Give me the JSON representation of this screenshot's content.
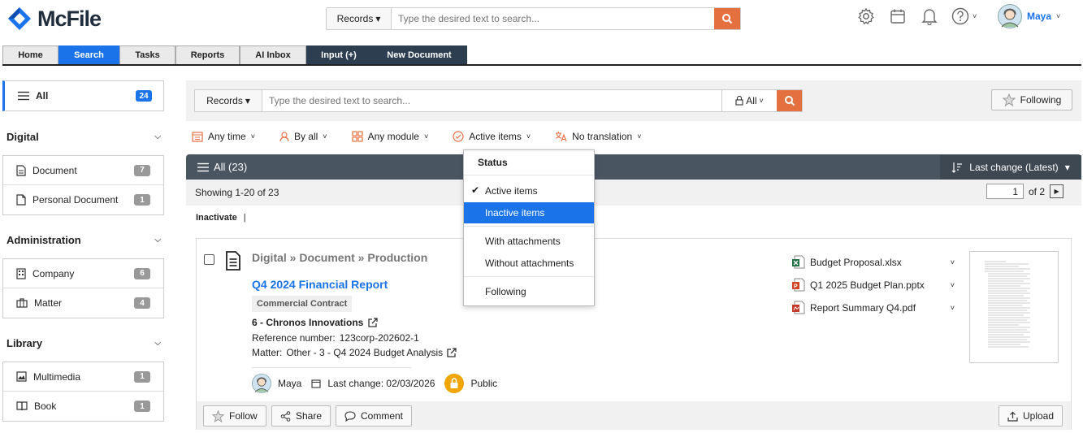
{
  "app": {
    "name": "McFile"
  },
  "top_search": {
    "scope": "Records",
    "placeholder": "Type the desired text to search..."
  },
  "user": {
    "name": "Maya"
  },
  "nav_tabs": [
    "Home",
    "Search",
    "Tasks",
    "Reports",
    "AI Inbox",
    "Input (+)",
    "New Document"
  ],
  "sidebar": {
    "all": {
      "label": "All",
      "count": "24"
    },
    "sections": [
      {
        "title": "Digital",
        "items": [
          {
            "label": "Document",
            "count": "7"
          },
          {
            "label": "Personal Document",
            "count": "1"
          }
        ]
      },
      {
        "title": "Administration",
        "items": [
          {
            "label": "Company",
            "count": "6"
          },
          {
            "label": "Matter",
            "count": "4"
          }
        ]
      },
      {
        "title": "Library",
        "items": [
          {
            "label": "Multimedia",
            "count": "1"
          },
          {
            "label": "Book",
            "count": "1"
          }
        ]
      }
    ]
  },
  "search": {
    "scope": "Records",
    "placeholder": "Type the desired text to search...",
    "filter_scope": "All",
    "following_label": "Following"
  },
  "filters": [
    "Any time",
    "By all",
    "Any module",
    "Active items",
    "No translation"
  ],
  "list": {
    "header": "All (23)",
    "sort": "Last change (Latest)",
    "showing": "Showing 1-20 of 23",
    "page": "1",
    "page_total": "of 2",
    "action": "Inactivate",
    "action_sep": "|"
  },
  "record": {
    "breadcrumb": "Digital » Document » Production",
    "title": "Q4 2024 Financial Report",
    "tag": "Commercial Contract",
    "company": "6 - Chronos Innovations",
    "reference_label": "Reference number:",
    "reference": "123corp-202602-1",
    "matter_label": "Matter:",
    "matter": "Other - 3 - Q4 2024 Budget Analysis",
    "owner": "Maya",
    "last_change": "Last change: 02/03/2026",
    "visibility": "Public",
    "attachments": [
      {
        "name": "Budget Proposal.xlsx",
        "icon": "excel-icon",
        "color": "#1d6f42"
      },
      {
        "name": "Q1 2025 Budget Plan.pptx",
        "icon": "powerpoint-icon",
        "color": "#d04423"
      },
      {
        "name": "Report Summary Q4.pdf",
        "icon": "pdf-icon",
        "color": "#c0392b"
      }
    ],
    "buttons": {
      "follow": "Follow",
      "share": "Share",
      "comment": "Comment",
      "upload": "Upload"
    }
  },
  "status_dropdown": {
    "title": "Status",
    "items": [
      "Active items",
      "Inactive items",
      "With attachments",
      "Without attachments",
      "Following"
    ],
    "checked": "Active items",
    "highlighted": "Inactive items"
  },
  "colors": {
    "accent": "#1a73e8",
    "search_button": "#e5703f",
    "header_dark": "#4a5562",
    "lock": "#f0a500"
  }
}
